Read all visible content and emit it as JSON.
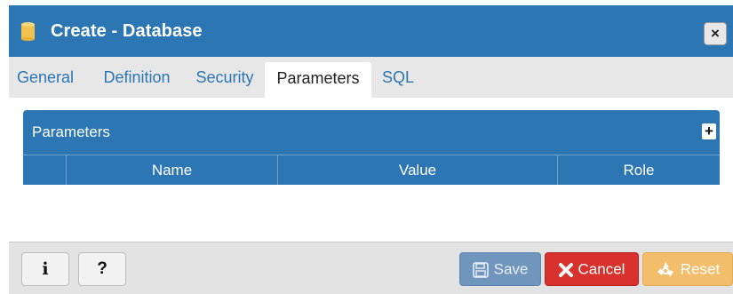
{
  "dialog": {
    "title": "Create - Database",
    "close_label": "×",
    "title_icon": "database-icon"
  },
  "tabs": [
    {
      "label": "General",
      "active": false
    },
    {
      "label": "Definition",
      "active": false
    },
    {
      "label": "Security",
      "active": false
    },
    {
      "label": "Parameters",
      "active": true
    },
    {
      "label": "SQL",
      "active": false
    }
  ],
  "panel": {
    "title": "Parameters",
    "add_label": "+",
    "columns": [
      "",
      "Name",
      "Value",
      "Role"
    ],
    "rows": []
  },
  "footer": {
    "info_label": "i",
    "help_label": "?",
    "save_label": "Save",
    "cancel_label": "Cancel",
    "reset_label": "Reset"
  },
  "colors": {
    "header_blue": "#2c76b3",
    "cancel_red": "#d9312e",
    "reset_orange": "#f3be6c",
    "save_blue_disabled": "#7096be",
    "db_icon_yellow": "#f2c24e"
  }
}
